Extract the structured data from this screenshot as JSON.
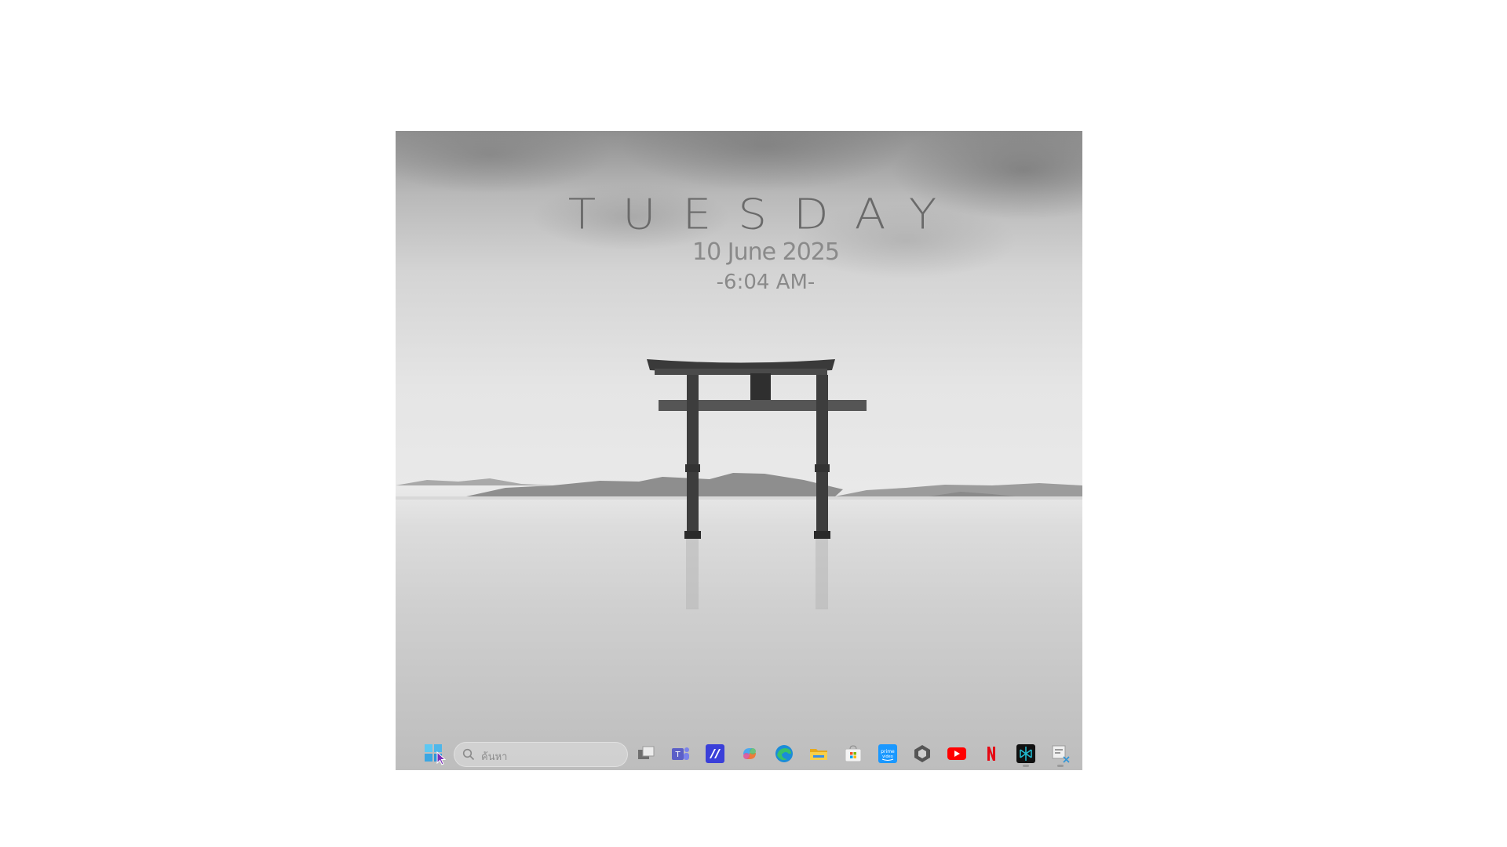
{
  "desktop": {
    "widget": {
      "day": "TUESDAY",
      "date": "10 June 2025",
      "time": "-6:04 AM-"
    }
  },
  "taskbar": {
    "start_icon": "windows-start-icon",
    "search": {
      "placeholder": "ค้นหา",
      "icon": "search-icon"
    },
    "apps": [
      {
        "name": "task-view",
        "icon": "task-view-icon"
      },
      {
        "name": "teams",
        "icon": "teams-icon"
      },
      {
        "name": "notes-app",
        "icon": "notes-app-icon"
      },
      {
        "name": "copilot",
        "icon": "copilot-icon"
      },
      {
        "name": "edge",
        "icon": "edge-icon"
      },
      {
        "name": "file-explorer",
        "icon": "folder-icon"
      },
      {
        "name": "microsoft-store",
        "icon": "store-icon"
      },
      {
        "name": "prime-video",
        "icon": "prime-video-icon"
      },
      {
        "name": "app-hex",
        "icon": "hexagon-app-icon"
      },
      {
        "name": "youtube",
        "icon": "youtube-icon"
      },
      {
        "name": "netflix",
        "icon": "netflix-icon"
      },
      {
        "name": "perplexity",
        "icon": "perplexity-icon"
      },
      {
        "name": "snipping-tool",
        "icon": "snipping-tool-icon"
      }
    ],
    "colors": {
      "teams": "#5b5fc7",
      "edge": "#1a8cd8",
      "folder": "#f4c542",
      "prime": "#1a98ff",
      "youtube": "#ff0000",
      "netflix": "#e50914",
      "perplexity": "#20b8cd"
    }
  }
}
